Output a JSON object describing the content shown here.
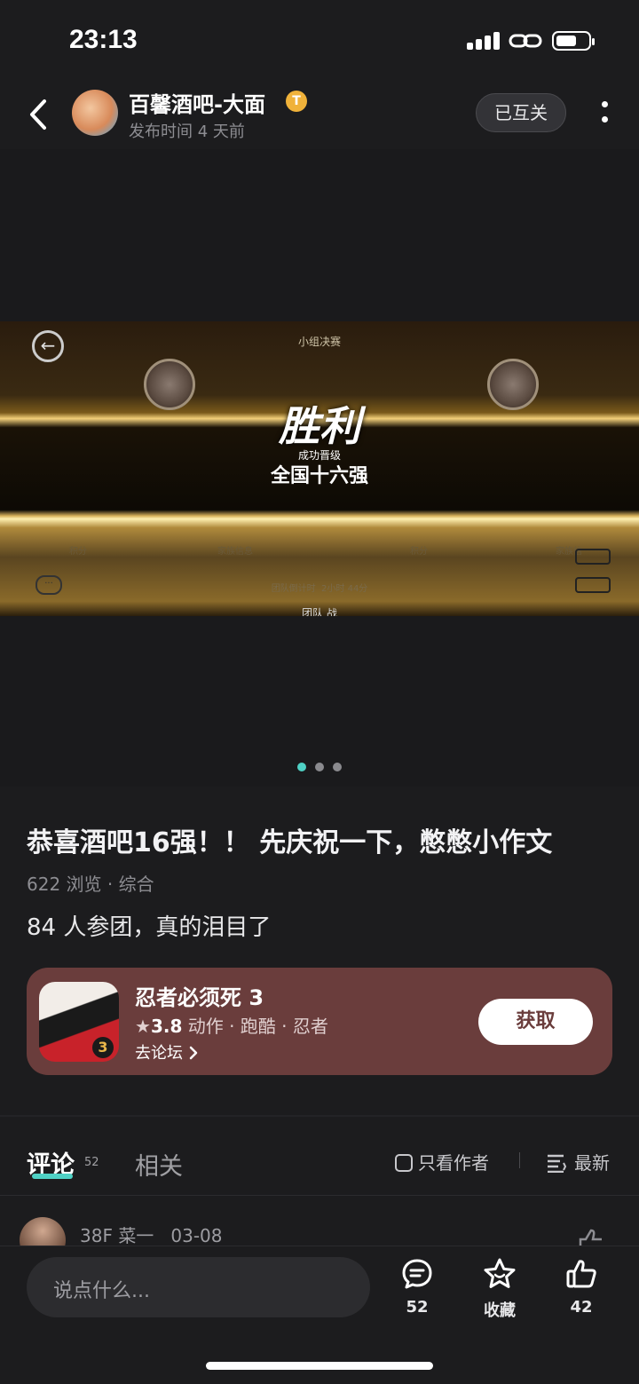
{
  "status_bar": {
    "time": "23:13"
  },
  "header": {
    "author": "百馨酒吧-大面",
    "badge": "T",
    "publish_time": "发布时间 4 天前",
    "follow_label": "已互关"
  },
  "screenshot": {
    "title": "小组决赛",
    "victory": "胜利",
    "advance_caption": "成功晋级",
    "advance_title": "全国十六强",
    "col1": "积分",
    "col2": "家族信息",
    "col3": "积分",
    "col4": "家族信",
    "countdown": "团队倒计时",
    "countdown_val": "2小时 44分",
    "team": "团队 战"
  },
  "carousel": {
    "count": 3,
    "active": 0
  },
  "post": {
    "title": "恭喜酒吧16强！！ 先庆祝一下，憋憋小作文",
    "meta": "622 浏览 · 综合",
    "body": "84 人参团，真的泪目了"
  },
  "game_card": {
    "name": "忍者必须死 3",
    "rating": "3.8",
    "tags": "动作 · 跑酷 · 忍者",
    "forum_link": "去论坛",
    "get_label": "获取",
    "icon_badge": "3"
  },
  "tabs": {
    "comments_label": "评论",
    "comments_count": "52",
    "related_label": "相关",
    "only_author": "只看作者",
    "sort_label": "最新"
  },
  "comment_preview": {
    "floor": "38F",
    "user": "菜一",
    "date": "03-08"
  },
  "bottom_bar": {
    "input_placeholder": "说点什么...",
    "comment_count": "52",
    "favorite_label": "收藏",
    "like_count": "42"
  }
}
